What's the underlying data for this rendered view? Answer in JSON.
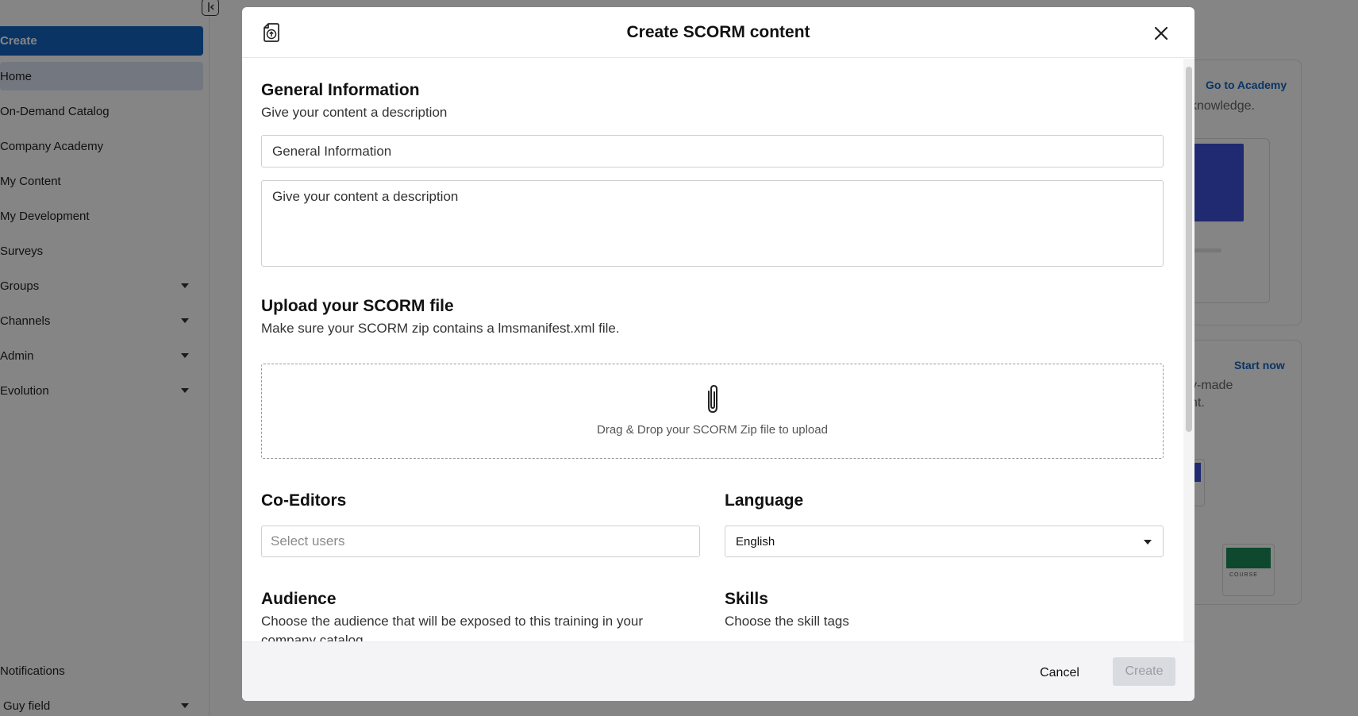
{
  "sidebar": {
    "create_label": "Create",
    "items": [
      {
        "label": "Home",
        "active": true,
        "has_caret": false
      },
      {
        "label": "On-Demand Catalog",
        "active": false,
        "has_caret": false
      },
      {
        "label": "Company Academy",
        "active": false,
        "has_caret": false
      },
      {
        "label": "My Content",
        "active": false,
        "has_caret": false
      },
      {
        "label": "My Development",
        "active": false,
        "has_caret": false
      },
      {
        "label": "Surveys",
        "active": false,
        "has_caret": false
      },
      {
        "label": "Groups",
        "active": false,
        "has_caret": true
      },
      {
        "label": "Channels",
        "active": false,
        "has_caret": true
      },
      {
        "label": "Admin",
        "active": false,
        "has_caret": true
      },
      {
        "label": "Evolution",
        "active": false,
        "has_caret": true
      }
    ],
    "notifications_label": "Notifications",
    "user_label": "Guy field"
  },
  "background": {
    "card1_link": "Go to Academy",
    "card1_text": "knowledge.",
    "card2_link": "Start now",
    "card2_text_1": "y-made",
    "card2_text_2": "nt.",
    "course_label": "COURSE"
  },
  "modal": {
    "title": "Create SCORM content",
    "general": {
      "heading": "General Information",
      "subheading": "Give your content a description",
      "title_value": "General Information",
      "description_value": "Give your content a description"
    },
    "upload": {
      "heading": "Upload your SCORM file",
      "subheading": "Make sure your SCORM zip contains a lmsmanifest.xml file.",
      "dropzone_text": "Drag & Drop your SCORM Zip file to upload"
    },
    "coeditors": {
      "heading": "Co-Editors",
      "placeholder": "Select users"
    },
    "language": {
      "heading": "Language",
      "selected": "English"
    },
    "audience": {
      "heading": "Audience",
      "subheading": "Choose the audience that will be exposed to this training in your company catalog"
    },
    "skills": {
      "heading": "Skills",
      "subheading": "Choose the skill tags"
    },
    "footer": {
      "cancel_label": "Cancel",
      "create_label": "Create"
    }
  },
  "colors": {
    "primary": "#1565c0",
    "active_nav": "#dce7f5",
    "disabled_button": "#d9dbe0"
  }
}
